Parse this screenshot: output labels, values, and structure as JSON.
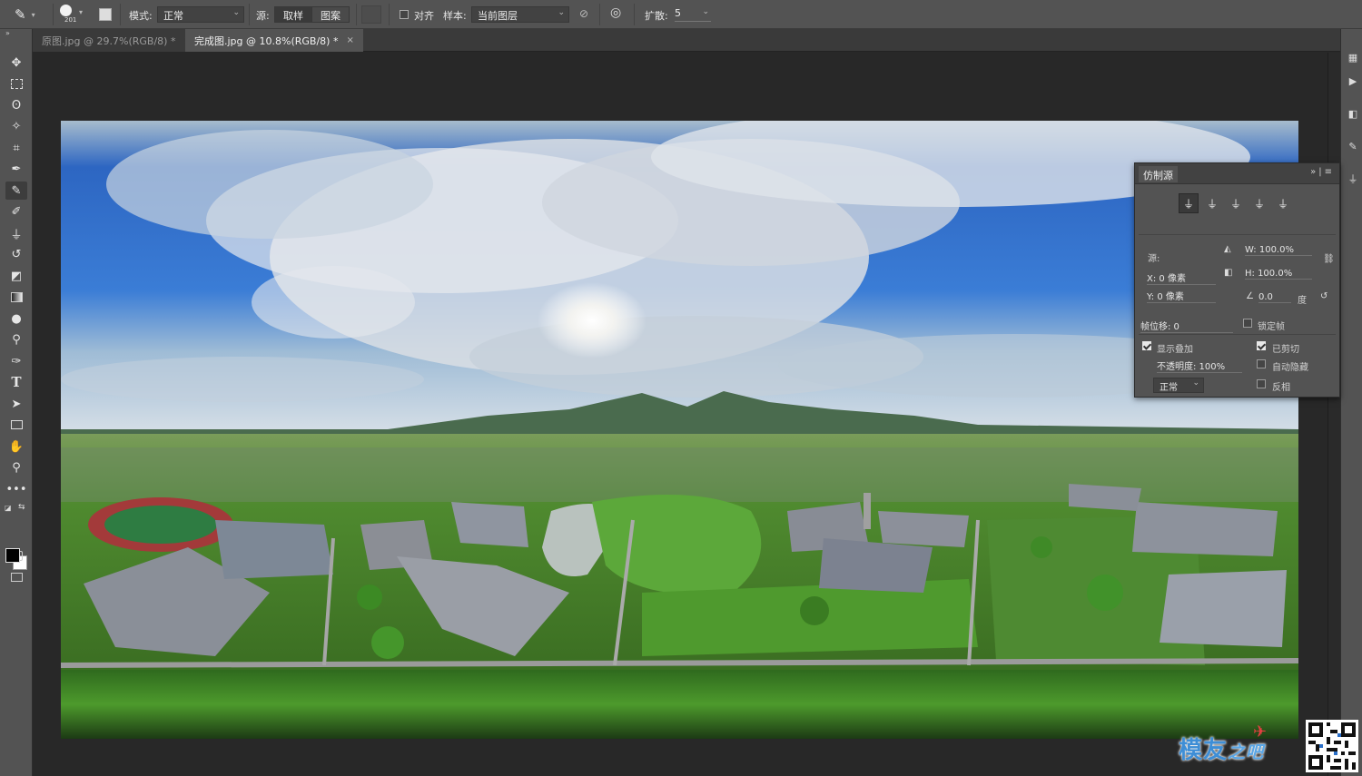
{
  "options_bar": {
    "brush_size": "201",
    "mode_label": "模式:",
    "mode_value": "正常",
    "source_label": "源:",
    "source_sampled": "取样",
    "source_pattern": "图案",
    "aligned_label": "对齐",
    "sample_label": "样本:",
    "sample_value": "当前图层",
    "diffusion_label": "扩散:",
    "diffusion_value": "5"
  },
  "tabs": [
    {
      "label": "原图.jpg @ 29.7%(RGB/8) *",
      "close": "×"
    },
    {
      "label": "完成图.jpg @ 10.8%(RGB/8) *",
      "close": "×"
    }
  ],
  "clone_panel": {
    "title": "仿制源",
    "source_label": "源:",
    "x_value": "X: 0 像素",
    "y_value": "Y: 0 像素",
    "w_value": "W: 100.0%",
    "h_value": "H: 100.0%",
    "angle_value": "0.0",
    "angle_unit": "度",
    "frame_offset": "帧位移: 0",
    "lock_frame": "锁定帧",
    "show_overlay": "显示叠加",
    "clipped": "已剪切",
    "opacity": "不透明度: 100%",
    "auto_hide": "自动隐藏",
    "blend_mode": "正常",
    "invert": "反相"
  },
  "watermark": {
    "main": "模友",
    "sub": "之吧"
  },
  "colors": {
    "ui_panel": "#535353",
    "ui_dark": "#282828",
    "sky_blue": "#2f6fc8",
    "grass_green": "#4f9a2a"
  }
}
